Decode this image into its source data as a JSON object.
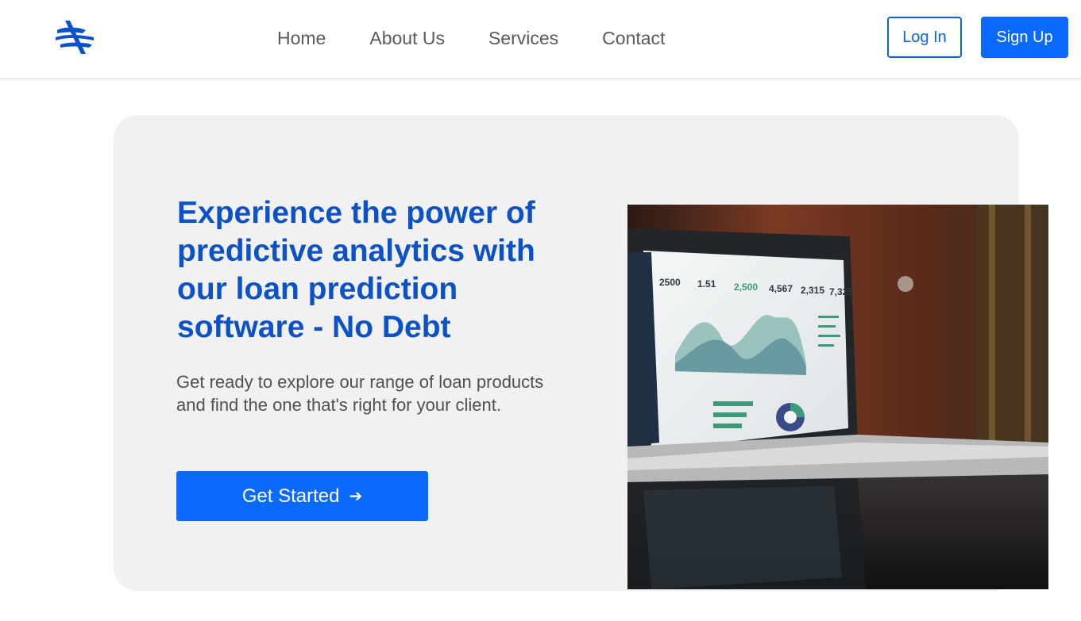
{
  "nav": {
    "logo_icon": "brand-logo-icon",
    "links": [
      "Home",
      "About Us",
      "Services",
      "Contact"
    ],
    "login_label": "Log In",
    "signup_label": "Sign Up"
  },
  "hero": {
    "title": "Experience the power of predictive analytics with our loan prediction software - No Debt",
    "subtitle": "Get ready to explore our range of loan products and find the one that's right for your client.",
    "cta_label": "Get Started",
    "cta_icon": "arrow-right-icon",
    "image_alt": "laptop-analytics-dashboard-photo"
  },
  "colors": {
    "brand_blue": "#0b52c9",
    "button_blue": "#0b6afc",
    "hero_bg": "#f1f1f2"
  }
}
